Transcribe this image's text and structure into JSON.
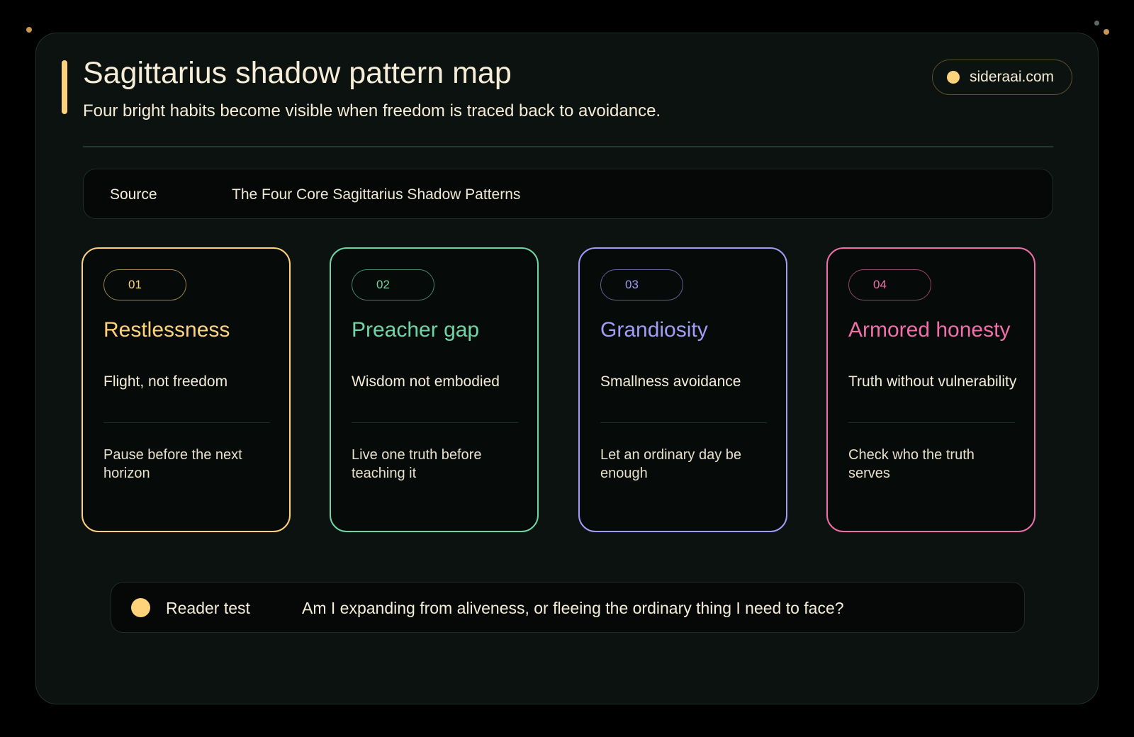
{
  "header": {
    "title": "Sagittarius shadow pattern map",
    "subtitle": "Four bright habits become visible when freedom is traced back to avoidance.",
    "site": "sideraai.com"
  },
  "source": {
    "label": "Source",
    "value": "The Four Core Sagittarius Shadow Patterns"
  },
  "cards": [
    {
      "number": "01",
      "title": "Restlessness",
      "tagline": "Flight, not freedom",
      "action": "Pause before the next horizon",
      "color": "#fdd27b"
    },
    {
      "number": "02",
      "title": "Preacher gap",
      "tagline": "Wisdom not embodied",
      "action": "Live one truth before teaching it",
      "color": "#6fd5a7"
    },
    {
      "number": "03",
      "title": "Grandiosity",
      "tagline": "Smallness avoidance",
      "action": "Let an ordinary day be enough",
      "color": "#a39bf5"
    },
    {
      "number": "04",
      "title": "Armored honesty",
      "tagline": "Truth without vulnerability",
      "action": "Check who the truth serves",
      "color": "#f06ea9"
    }
  ],
  "reader_test": {
    "label": "Reader test",
    "question": "Am I expanding from aliveness, or fleeing the ordinary thing I need to face?"
  },
  "colors": {
    "accent": "#fdd27b",
    "panel_background": "#0b120f",
    "page_background": "#000000",
    "text": "#f5edd8"
  }
}
